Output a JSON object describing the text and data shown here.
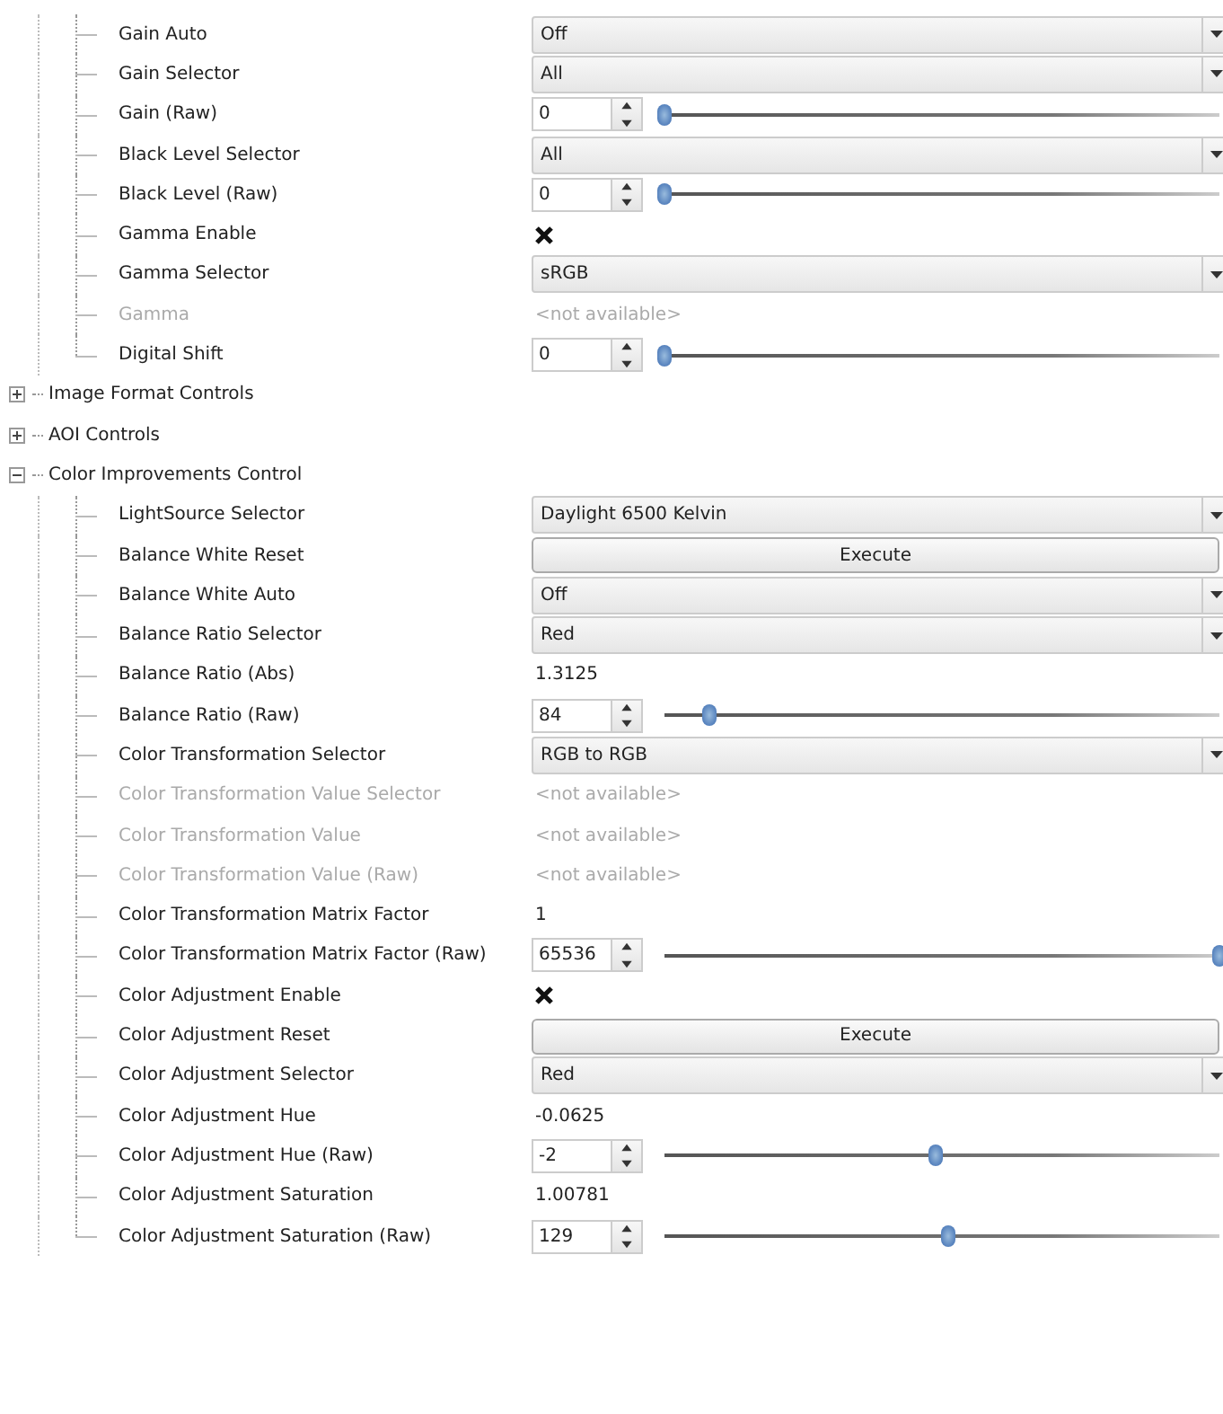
{
  "tree": [
    {
      "children": [
        {
          "label": "Gain Auto",
          "kind": "combo",
          "value": "Off",
          "disabled": false
        },
        {
          "label": "Gain Selector",
          "kind": "combo",
          "value": "All",
          "disabled": false
        },
        {
          "label": "Gain (Raw)",
          "kind": "spin",
          "value": "0",
          "level": 0,
          "disabled": false
        },
        {
          "label": "Black Level Selector",
          "kind": "combo",
          "value": "All",
          "disabled": false
        },
        {
          "label": "Black Level (Raw)",
          "kind": "spin",
          "value": "0",
          "level": 0,
          "disabled": false
        },
        {
          "label": "Gamma Enable",
          "kind": "check",
          "checked": true,
          "disabled": false
        },
        {
          "label": "Gamma Selector",
          "kind": "combo",
          "value": "sRGB",
          "disabled": false
        },
        {
          "label": "Gamma",
          "kind": "text",
          "value": "<not available>",
          "disabled": true
        },
        {
          "label": "Digital Shift",
          "kind": "spin",
          "value": "0",
          "level": 0,
          "disabled": false
        }
      ]
    },
    {
      "label": "Image Format Controls",
      "expanded": false
    },
    {
      "label": "AOI Controls",
      "expanded": false
    },
    {
      "label": "Color Improvements Control",
      "expanded": true,
      "children": [
        {
          "label": "LightSource Selector",
          "kind": "combo",
          "value": "Daylight 6500 Kelvin",
          "disabled": false
        },
        {
          "label": "Balance White Reset",
          "kind": "button",
          "value": "Execute",
          "disabled": false
        },
        {
          "label": "Balance White Auto",
          "kind": "combo",
          "value": "Off",
          "disabled": false
        },
        {
          "label": "Balance Ratio Selector",
          "kind": "combo",
          "value": "Red",
          "disabled": false
        },
        {
          "label": "Balance Ratio (Abs)",
          "kind": "text",
          "value": "1.3125",
          "disabled": false
        },
        {
          "label": "Balance Ratio (Raw)",
          "kind": "spin",
          "value": "84",
          "level": 0.08,
          "disabled": false
        },
        {
          "label": "Color Transformation Selector",
          "kind": "combo",
          "value": "RGB to RGB",
          "disabled": false
        },
        {
          "label": "Color Transformation Value Selector",
          "kind": "text",
          "value": "<not available>",
          "disabled": true
        },
        {
          "label": "Color Transformation Value",
          "kind": "text",
          "value": "<not available>",
          "disabled": true
        },
        {
          "label": "Color Transformation Value (Raw)",
          "kind": "text",
          "value": "<not available>",
          "disabled": true
        },
        {
          "label": "Color Transformation Matrix Factor",
          "kind": "text",
          "value": "1",
          "disabled": false
        },
        {
          "label": "Color Transformation Matrix Factor (Raw)",
          "kind": "spin",
          "value": "65536",
          "level": 1,
          "disabled": false
        },
        {
          "label": "Color Adjustment Enable",
          "kind": "check",
          "checked": true,
          "disabled": false
        },
        {
          "label": "Color Adjustment Reset",
          "kind": "button",
          "value": "Execute",
          "disabled": false
        },
        {
          "label": "Color Adjustment Selector",
          "kind": "combo",
          "value": "Red",
          "disabled": false
        },
        {
          "label": "Color Adjustment Hue",
          "kind": "text",
          "value": "-0.0625",
          "disabled": false
        },
        {
          "label": "Color Adjustment Hue (Raw)",
          "kind": "spin",
          "value": "-2",
          "level": 0.49,
          "disabled": false
        },
        {
          "label": "Color Adjustment Saturation",
          "kind": "text",
          "value": "1.00781",
          "disabled": false
        },
        {
          "label": "Color Adjustment Saturation (Raw)",
          "kind": "spin",
          "value": "129",
          "level": 0.51,
          "disabled": false
        }
      ]
    }
  ]
}
